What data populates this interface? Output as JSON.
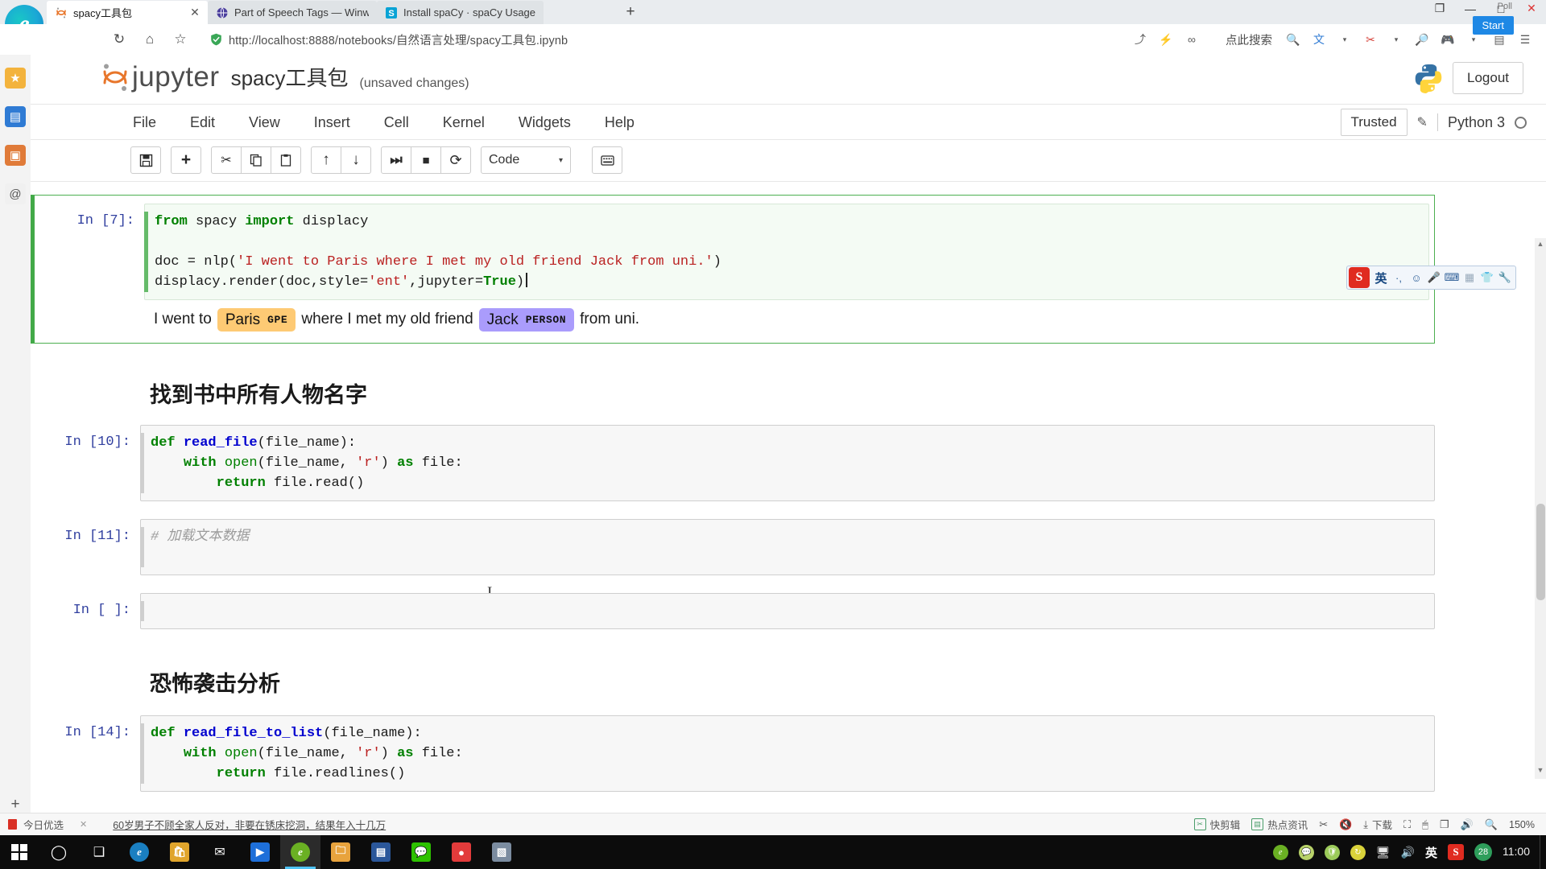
{
  "browser": {
    "tabs": [
      {
        "title": "spacy工具包",
        "favicon": "jupyter-icon",
        "active": true,
        "closable": true
      },
      {
        "title": "Part of Speech Tags — Winw",
        "favicon": "globe-icon",
        "active": false,
        "closable": false
      },
      {
        "title": "Install spaCy · spaCy Usage",
        "favicon": "spacy-icon",
        "active": false,
        "closable": false
      }
    ],
    "new_tab_label": "+",
    "window_controls": {
      "restore": "❐",
      "minimize": "—",
      "maximize": "□",
      "close": "✕"
    },
    "nav": {
      "reload_icon": "reload-icon",
      "home_icon": "home-icon",
      "favorite_icon": "star-icon",
      "shield_icon": "shield-icon",
      "url_protocol": "http://",
      "url_host": "localhost",
      "url_rest": ":8888/notebooks/自然语言处理/spacy工具包.ipynb",
      "url_full": "http://localhost:8888/notebooks/自然语言处理/spacy工具包.ipynb",
      "search_hint": "点此搜索",
      "right_icons": [
        "share-icon",
        "lightning-icon",
        "link-icon",
        "search-icon",
        "translate-icon",
        "scissors-icon",
        "magnifier-icon",
        "gamepad-icon",
        "dots-icon",
        "collections-icon",
        "menu-icon"
      ]
    },
    "start_badge": "Start",
    "poll_label": "Poll",
    "rail_icons": [
      "favorites-icon",
      "reading-list-icon",
      "books-icon",
      "history-icon",
      "downloads-icon"
    ],
    "rail_add": "+"
  },
  "jupyter": {
    "logo_word": "jupyter",
    "notebook_title": "spacy工具包",
    "dirty_state": "(unsaved changes)",
    "logout_label": "Logout",
    "menu": [
      "File",
      "Edit",
      "View",
      "Insert",
      "Cell",
      "Kernel",
      "Widgets",
      "Help"
    ],
    "trusted_label": "Trusted",
    "pencil_icon": "pencil-icon",
    "kernel_name": "Python 3",
    "toolbar": {
      "buttons": [
        {
          "name": "save-button",
          "glyph": "💾"
        },
        {
          "name": "insert-cell-button",
          "glyph": "+"
        },
        {
          "name": "cut-cell-button",
          "glyph": "✂"
        },
        {
          "name": "copy-cell-button",
          "glyph": "❐"
        },
        {
          "name": "paste-cell-button",
          "glyph": "📋"
        },
        {
          "name": "move-cell-up-button",
          "glyph": "↑"
        },
        {
          "name": "move-cell-down-button",
          "glyph": "↓"
        },
        {
          "name": "run-cell-button",
          "glyph": "⏭"
        },
        {
          "name": "interrupt-kernel-button",
          "glyph": "■"
        },
        {
          "name": "restart-kernel-button",
          "glyph": "↻"
        }
      ],
      "celltype_value": "Code",
      "celltype_caret": "▾",
      "command_palette_glyph": "⌨"
    }
  },
  "notebook_cells": [
    {
      "prompt": "In [7]:",
      "selected": true,
      "code_lines": [
        [
          {
            "t": "from ",
            "c": "kw"
          },
          {
            "t": "spacy ",
            "c": "op"
          },
          {
            "t": "import ",
            "c": "kw"
          },
          {
            "t": "displacy",
            "c": "op"
          }
        ],
        [
          {
            "t": "",
            "c": "op"
          }
        ],
        [
          {
            "t": "doc = nlp(",
            "c": "op"
          },
          {
            "t": "'I went to Paris where I met my old friend Jack from uni.'",
            "c": "str"
          },
          {
            "t": ")",
            "c": "op"
          }
        ],
        [
          {
            "t": "displacy.render(doc,style=",
            "c": "op"
          },
          {
            "t": "'ent'",
            "c": "str"
          },
          {
            "t": ",jupyter=",
            "c": "op"
          },
          {
            "t": "True",
            "c": "kw"
          },
          {
            "t": ")",
            "c": "op"
          }
        ]
      ],
      "has_cursor": true,
      "output": {
        "type": "entities",
        "tokens": [
          {
            "kind": "text",
            "text": "I went to "
          },
          {
            "kind": "entity",
            "text": "Paris",
            "label": "GPE",
            "color": "#feca74"
          },
          {
            "kind": "text",
            "text": "where I met my old friend "
          },
          {
            "kind": "entity",
            "text": "Jack",
            "label": "PERSON",
            "color": "#aa9cfc"
          },
          {
            "kind": "text",
            "text": "from uni."
          }
        ]
      }
    },
    {
      "type": "markdown",
      "heading": "找到书中所有人物名字"
    },
    {
      "prompt": "In [10]:",
      "selected": false,
      "code_lines": [
        [
          {
            "t": "def ",
            "c": "kw"
          },
          {
            "t": "read_file",
            "c": "fn"
          },
          {
            "t": "(file_name):",
            "c": "op"
          }
        ],
        [
          {
            "t": "    ",
            "c": "op"
          },
          {
            "t": "with ",
            "c": "kw"
          },
          {
            "t": "open",
            "c": "bi"
          },
          {
            "t": "(file_name, ",
            "c": "op"
          },
          {
            "t": "'r'",
            "c": "str"
          },
          {
            "t": ") ",
            "c": "op"
          },
          {
            "t": "as ",
            "c": "kw"
          },
          {
            "t": "file:",
            "c": "op"
          }
        ],
        [
          {
            "t": "        ",
            "c": "op"
          },
          {
            "t": "return ",
            "c": "kw"
          },
          {
            "t": "file.read()",
            "c": "op"
          }
        ]
      ],
      "has_cursor": false
    },
    {
      "prompt": "In [11]:",
      "selected": false,
      "code_lines": [
        [
          {
            "t": "# 加载文本数据",
            "c": "cm"
          }
        ],
        [
          {
            "t": "",
            "c": "op"
          }
        ]
      ],
      "has_cursor": false
    },
    {
      "prompt": "In [ ]:",
      "selected": false,
      "code_lines": [
        [
          {
            "t": "",
            "c": "op"
          }
        ]
      ],
      "has_cursor": false
    },
    {
      "type": "markdown",
      "heading": "恐怖袭击分析"
    },
    {
      "prompt": "In [14]:",
      "selected": false,
      "code_lines": [
        [
          {
            "t": "def ",
            "c": "kw"
          },
          {
            "t": "read_file_to_list",
            "c": "fn"
          },
          {
            "t": "(file_name):",
            "c": "op"
          }
        ],
        [
          {
            "t": "    ",
            "c": "op"
          },
          {
            "t": "with ",
            "c": "kw"
          },
          {
            "t": "open",
            "c": "bi"
          },
          {
            "t": "(file_name, ",
            "c": "op"
          },
          {
            "t": "'r'",
            "c": "str"
          },
          {
            "t": ") ",
            "c": "op"
          },
          {
            "t": "as ",
            "c": "kw"
          },
          {
            "t": "file:",
            "c": "op"
          }
        ],
        [
          {
            "t": "        ",
            "c": "op"
          },
          {
            "t": "return ",
            "c": "kw"
          },
          {
            "t": "file.readlines()",
            "c": "op"
          }
        ]
      ],
      "has_cursor": false
    }
  ],
  "ime_bar": {
    "logo": "S",
    "mode_label": "英",
    "icons": [
      "punctuation-icon",
      "emoji-icon",
      "microphone-icon",
      "keyboard-icon",
      "toolbox-icon",
      "skin-icon",
      "settings-icon"
    ]
  },
  "status_bar": {
    "feed_label": "今日优选",
    "close_glyph": "✕",
    "news_headline": "60岁男子不顾全家人反对，非要在锈床挖洞，结果年入十几万",
    "right_items": [
      {
        "label": "快剪辑",
        "icon": "clip-icon"
      },
      {
        "label": "热点资讯",
        "icon": "news-icon"
      }
    ],
    "right_icons": [
      "screenshot-icon",
      "mute-icon",
      "download-icon",
      "fullscreen-icon",
      "mouse-icon",
      "window-icon",
      "volume-icon",
      "zoom-icon"
    ],
    "download_label": "下载",
    "zoom_level": "150%"
  },
  "taskbar": {
    "start_icon": "windows-icon",
    "apps": [
      {
        "name": "cortana-icon",
        "glyph": "○",
        "color": "#ffffff",
        "bg": "transparent",
        "active": false
      },
      {
        "name": "task-view-icon",
        "glyph": "❑",
        "color": "#ffffff",
        "bg": "transparent",
        "active": false
      },
      {
        "name": "edge-icon",
        "glyph": "e",
        "color": "#ffffff",
        "bg": "#1a7fc1",
        "active": false
      },
      {
        "name": "store-icon",
        "glyph": "🛒",
        "color": "#ffffff",
        "bg": "#d4a017",
        "active": false
      },
      {
        "name": "mail-icon",
        "glyph": "✉",
        "color": "#ffffff",
        "bg": "transparent",
        "active": false
      },
      {
        "name": "video-player-icon",
        "glyph": "▶",
        "color": "#ffffff",
        "bg": "#1e6fd9",
        "active": false
      },
      {
        "name": "browser-360-icon",
        "glyph": "e",
        "color": "#ffffff",
        "bg": "#6ab023",
        "active": true
      },
      {
        "name": "file-explorer-icon",
        "glyph": "📁",
        "color": "#ffffff",
        "bg": "#e8a33d",
        "active": false
      },
      {
        "name": "office-icon",
        "glyph": "▤",
        "color": "#ffffff",
        "bg": "#2b579a",
        "active": false
      },
      {
        "name": "wechat-icon",
        "glyph": "💬",
        "color": "#ffffff",
        "bg": "#2dc100",
        "active": false
      },
      {
        "name": "recorder-icon",
        "glyph": "●",
        "color": "#ffffff",
        "bg": "#e23b3b",
        "active": false
      },
      {
        "name": "photos-icon",
        "glyph": "◰",
        "color": "#ffffff",
        "bg": "#7b8ca0",
        "active": false
      }
    ],
    "tray": {
      "icons": [
        "edge-tray-icon",
        "chat-icon",
        "shield-tray-icon",
        "update-icon",
        "display-icon",
        "volume-tray-icon"
      ],
      "ime_label": "英",
      "sogou_label": "S",
      "badge_number": "28",
      "clock_time": "11:00"
    }
  }
}
